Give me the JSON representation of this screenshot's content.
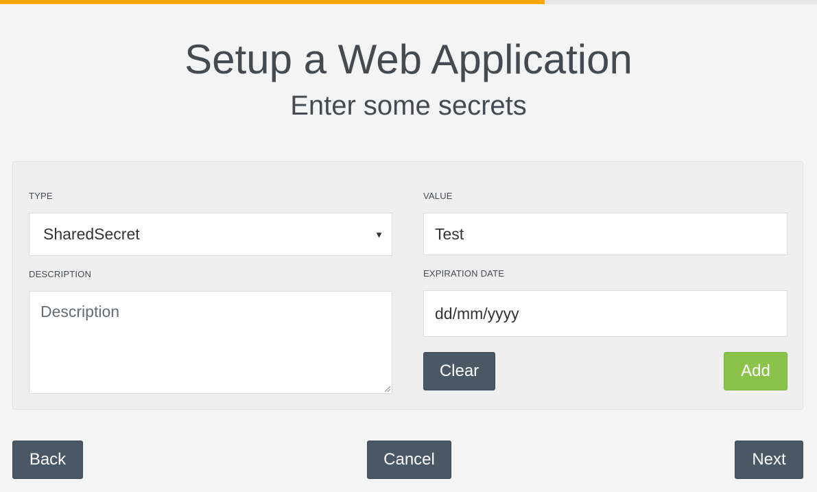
{
  "progress": {
    "fraction": 0.667
  },
  "header": {
    "title": "Setup a Web Application",
    "subtitle": "Enter some secrets"
  },
  "form": {
    "type": {
      "label": "TYPE",
      "value": "SharedSecret"
    },
    "value": {
      "label": "VALUE",
      "value": "Test"
    },
    "description": {
      "label": "DESCRIPTION",
      "placeholder": "Description"
    },
    "expiration": {
      "label": "EXPIRATION DATE",
      "placeholder": "dd/mm/yyyy"
    },
    "clear_label": "Clear",
    "add_label": "Add"
  },
  "footer": {
    "back_label": "Back",
    "cancel_label": "Cancel",
    "next_label": "Next"
  },
  "colors": {
    "accent": "#ffa600",
    "button": "#4a5866",
    "add_button": "#8bc34a"
  }
}
